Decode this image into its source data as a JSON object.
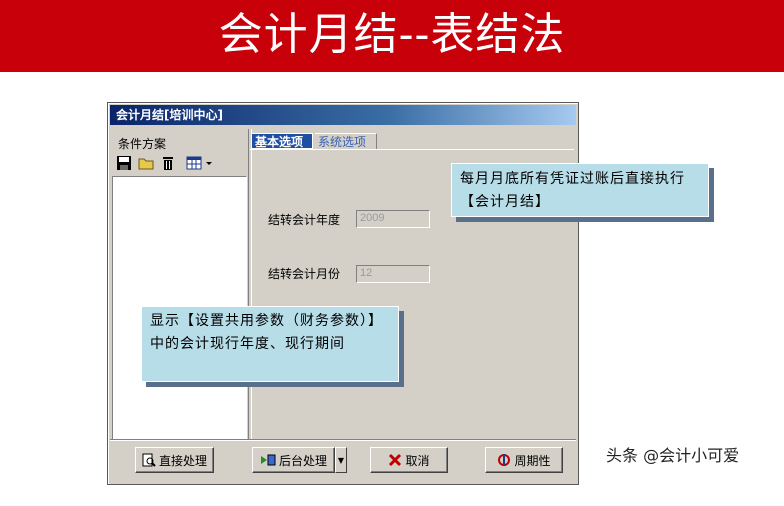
{
  "slide": {
    "title": "会计月结--表结法",
    "banner_color": "#c8000a"
  },
  "window": {
    "title": "会计月结[培训中心]",
    "left_panel": {
      "label": "条件方案",
      "toolbar_icons": [
        "save-icon",
        "open-folder-icon",
        "delete-trash-icon",
        "grid-view-icon"
      ]
    },
    "tabs": [
      {
        "label": "基本选项",
        "active": true
      },
      {
        "label": "系统选项",
        "active": false
      }
    ],
    "fields": {
      "year_label": "结转会计年度",
      "year_value": "2009",
      "month_label": "结转会计月份",
      "month_value": "12"
    },
    "buttons": {
      "direct": "直接处理",
      "background": "后台处理",
      "cancel": "取消",
      "periodic": "周期性"
    }
  },
  "callouts": {
    "top": "每月月底所有凭证过账后直接执行【会计月结】",
    "bottom": "显示【设置共用参数（财务参数）】中的会计现行年度、现行期间"
  },
  "watermark": "头条 @会计小可爱"
}
